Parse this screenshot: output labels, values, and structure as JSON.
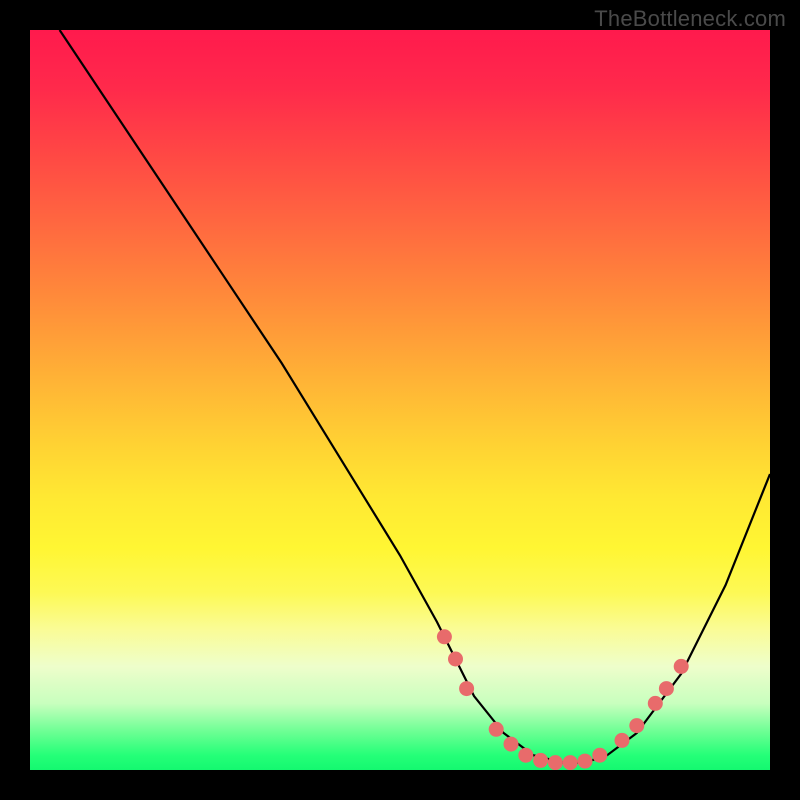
{
  "watermark": "TheBottleneck.com",
  "chart_data": {
    "type": "line",
    "title": "",
    "xlabel": "",
    "ylabel": "",
    "xlim": [
      0,
      100
    ],
    "ylim": [
      0,
      100
    ],
    "grid": false,
    "legend": false,
    "series": [
      {
        "name": "curve",
        "x": [
          4,
          10,
          18,
          26,
          34,
          42,
          50,
          55,
          57,
          60,
          64,
          68,
          72,
          75,
          78,
          82,
          88,
          94,
          100
        ],
        "y": [
          100,
          91,
          79,
          67,
          55,
          42,
          29,
          20,
          16,
          10,
          5,
          2,
          1,
          1,
          2,
          5,
          13,
          25,
          40
        ],
        "color": "#000000"
      }
    ],
    "markers": [
      {
        "x": 56,
        "y": 18,
        "color": "#e86b6b"
      },
      {
        "x": 57.5,
        "y": 15,
        "color": "#e86b6b"
      },
      {
        "x": 59,
        "y": 11,
        "color": "#e86b6b"
      },
      {
        "x": 63,
        "y": 5.5,
        "color": "#e86b6b"
      },
      {
        "x": 65,
        "y": 3.5,
        "color": "#e86b6b"
      },
      {
        "x": 67,
        "y": 2,
        "color": "#e86b6b"
      },
      {
        "x": 69,
        "y": 1.3,
        "color": "#e86b6b"
      },
      {
        "x": 71,
        "y": 1,
        "color": "#e86b6b"
      },
      {
        "x": 73,
        "y": 1,
        "color": "#e86b6b"
      },
      {
        "x": 75,
        "y": 1.2,
        "color": "#e86b6b"
      },
      {
        "x": 77,
        "y": 2,
        "color": "#e86b6b"
      },
      {
        "x": 80,
        "y": 4,
        "color": "#e86b6b"
      },
      {
        "x": 82,
        "y": 6,
        "color": "#e86b6b"
      },
      {
        "x": 84.5,
        "y": 9,
        "color": "#e86b6b"
      },
      {
        "x": 86,
        "y": 11,
        "color": "#e86b6b"
      },
      {
        "x": 88,
        "y": 14,
        "color": "#e86b6b"
      }
    ],
    "gradient_colors": {
      "top": "#ff1a4d",
      "mid_upper": "#ff8a3a",
      "mid": "#ffe833",
      "mid_lower": "#fafc96",
      "bottom": "#14f870"
    }
  }
}
